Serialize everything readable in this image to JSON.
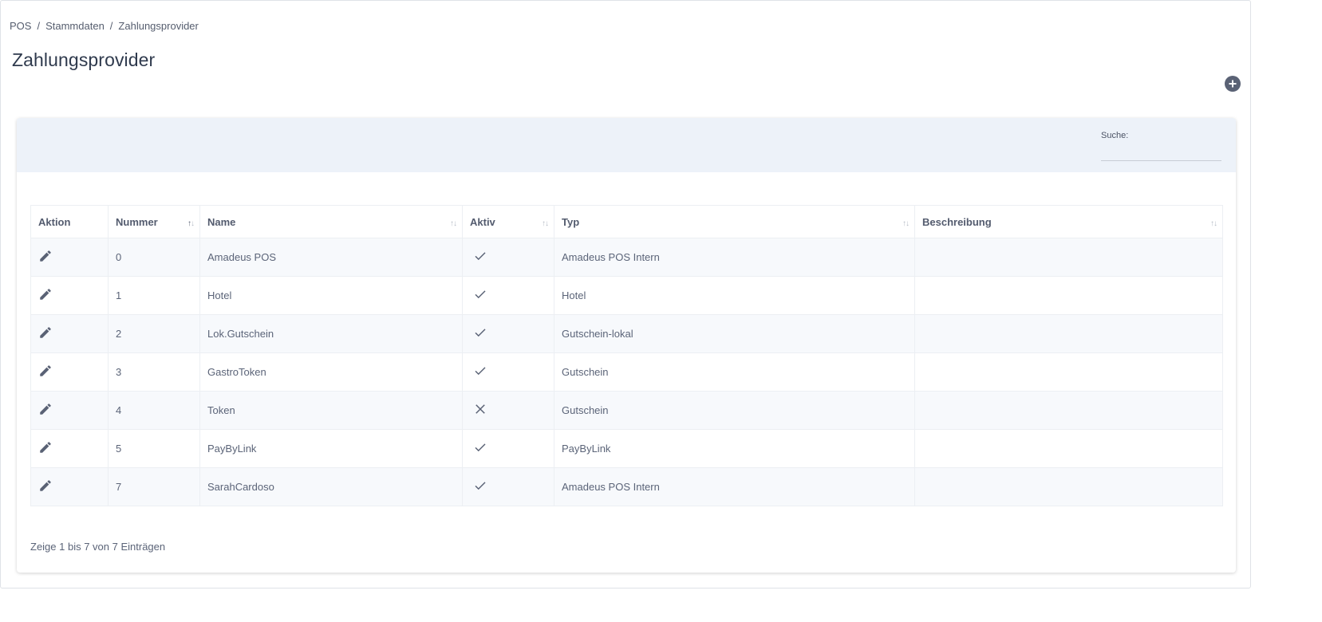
{
  "breadcrumb": [
    "POS",
    "Stammdaten",
    "Zahlungsprovider"
  ],
  "breadcrumb_separator": "/",
  "page_title": "Zahlungsprovider",
  "add_button_icon": "plus-circle-icon",
  "search": {
    "label": "Suche:",
    "value": "",
    "placeholder": ""
  },
  "table": {
    "columns": [
      "Aktion",
      "Nummer",
      "Name",
      "Aktiv",
      "Typ",
      "Beschreibung"
    ],
    "sort_indicator": "↑↓",
    "rows": [
      {
        "action_icon": "pencil-icon",
        "nummer": "0",
        "name": "Amadeus POS",
        "aktiv": true,
        "typ": "Amadeus POS Intern",
        "beschreibung": ""
      },
      {
        "action_icon": "pencil-icon",
        "nummer": "1",
        "name": "Hotel",
        "aktiv": true,
        "typ": "Hotel",
        "beschreibung": ""
      },
      {
        "action_icon": "pencil-icon",
        "nummer": "2",
        "name": "Lok.Gutschein",
        "aktiv": true,
        "typ": "Gutschein-lokal",
        "beschreibung": ""
      },
      {
        "action_icon": "pencil-icon",
        "nummer": "3",
        "name": "GastroToken",
        "aktiv": true,
        "typ": "Gutschein",
        "beschreibung": ""
      },
      {
        "action_icon": "pencil-icon",
        "nummer": "4",
        "name": "Token",
        "aktiv": false,
        "typ": "Gutschein",
        "beschreibung": ""
      },
      {
        "action_icon": "pencil-icon",
        "nummer": "5",
        "name": "PayByLink",
        "aktiv": true,
        "typ": "PayByLink",
        "beschreibung": ""
      },
      {
        "action_icon": "pencil-icon",
        "nummer": "7",
        "name": "SarahCardoso",
        "aktiv": true,
        "typ": "Amadeus POS Intern",
        "beschreibung": ""
      }
    ]
  },
  "footer_info": "Zeige 1 bis 7 von 7 Einträgen",
  "colors": {
    "icon": "#5a6275",
    "header_band": "#edf2f9",
    "stripe": "#f7f9fc",
    "title": "#2f3a4d"
  }
}
